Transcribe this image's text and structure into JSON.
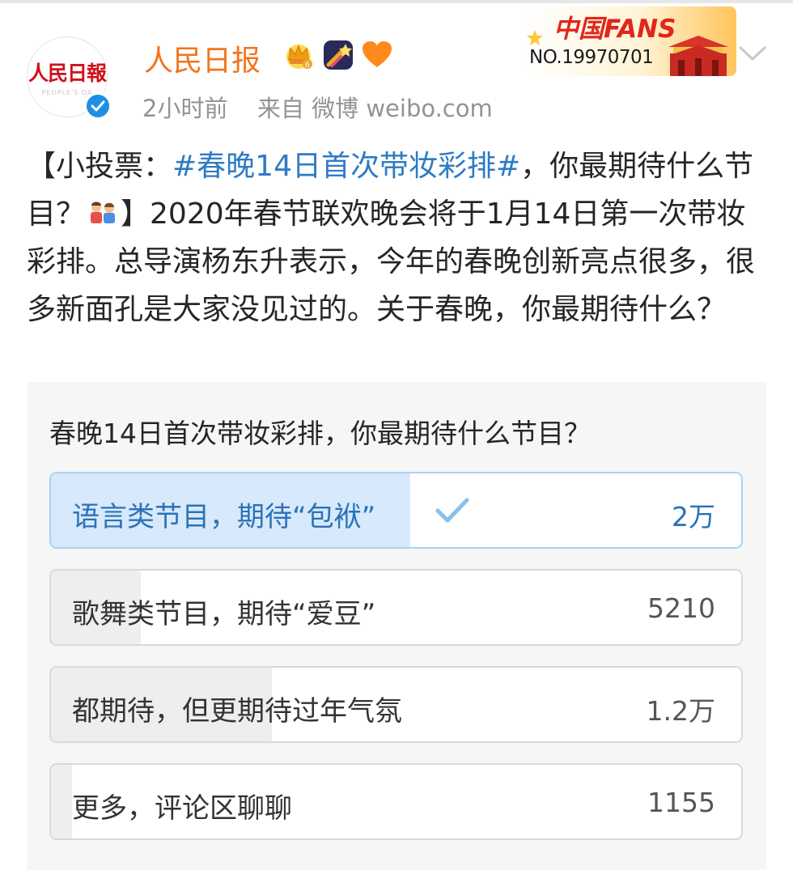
{
  "post": {
    "author": {
      "name": "人民日报",
      "avatar_text": "人民日報",
      "avatar_subtext": "PEOPLE'S DA",
      "badges": [
        "crown-icon",
        "shooting-star-icon",
        "heart-icon"
      ]
    },
    "meta": {
      "time": "2小时前",
      "source_label": "来自 微博 weibo.com"
    },
    "fans_badge": {
      "title": "中国FANS",
      "number": "NO.19970701"
    },
    "text": {
      "prefix": "【小投票：",
      "hashtag": "#春晚14日首次带妆彩排#",
      "middle": "，你最期待什么节目？",
      "suffix": "】2020年春节联欢晚会将于1月14日第一次带妆彩排。总导演杨东升表示，今年的春晚创新亮点很多，很多新面孔是大家没见过的。关于春晚，你最期待什么？"
    }
  },
  "poll": {
    "question": "春晚14日首次带妆彩排，你最期待什么节目？",
    "options": [
      {
        "label": "语言类节目，期待“包袱”",
        "count": "2万",
        "fill_percent": 52,
        "selected": true
      },
      {
        "label": "歌舞类节目，期待“爱豆”",
        "count": "5210",
        "fill_percent": 13,
        "selected": false
      },
      {
        "label": "都期待，但更期待过年气氛",
        "count": "1.2万",
        "fill_percent": 32,
        "selected": false
      },
      {
        "label": "更多，评论区聊聊",
        "count": "1155",
        "fill_percent": 3,
        "selected": false
      }
    ]
  },
  "colors": {
    "author_name": "#f3741b",
    "hashtag": "#2e7bc4",
    "verified": "#1e8fe3",
    "selected_fill": "#d7e9fa",
    "selected_text": "#2a72b8"
  }
}
